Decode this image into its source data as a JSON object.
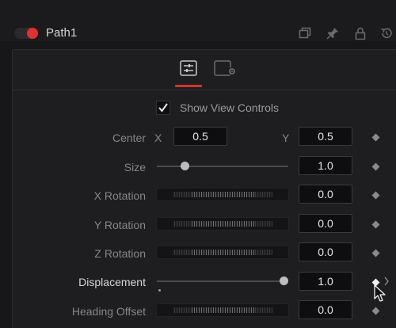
{
  "header": {
    "title": "Path1",
    "toggle_color": "#e1302d",
    "icons": [
      "copy-icon",
      "pin-icon",
      "lock-icon",
      "reset-icon"
    ]
  },
  "tabs": [
    {
      "name": "controls-tab",
      "icon": "sliders-icon",
      "active": true
    },
    {
      "name": "settings-tab",
      "icon": "gear-icon",
      "active": false
    }
  ],
  "show_view_controls": {
    "label": "Show View Controls",
    "checked": true
  },
  "center": {
    "label": "Center",
    "x_label": "X",
    "x_value": "0.5",
    "y_label": "Y",
    "y_value": "0.5"
  },
  "size": {
    "label": "Size",
    "value": "1.0",
    "slider_fraction": 0.2
  },
  "x_rotation": {
    "label": "X Rotation",
    "value": "0.0"
  },
  "y_rotation": {
    "label": "Y Rotation",
    "value": "0.0"
  },
  "z_rotation": {
    "label": "Z Rotation",
    "value": "0.0"
  },
  "displacement": {
    "label": "Displacement",
    "value": "1.0",
    "slider_fraction": 1.0
  },
  "heading_offset": {
    "label": "Heading Offset",
    "value": "0.0"
  },
  "colors": {
    "accent": "#d9322f",
    "background": "#17171a"
  }
}
